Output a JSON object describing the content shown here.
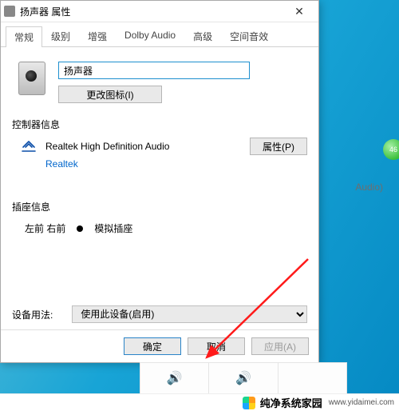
{
  "background": {
    "audio_label": "Audio)"
  },
  "dialog": {
    "title": "扬声器 属性",
    "tabs": [
      "常规",
      "级别",
      "增强",
      "Dolby Audio",
      "高级",
      "空间音效"
    ],
    "ok": "确定",
    "cancel": "取消",
    "apply": "应用(A)"
  },
  "general": {
    "device_name": "扬声器",
    "change_icon_label": "更改图标(I)",
    "controller_section": "控制器信息",
    "controller_name": "Realtek High Definition Audio",
    "provider": "Realtek",
    "properties_label": "属性(P)",
    "jack_section": "插座信息",
    "jack_channels": "左前 右前",
    "jack_type": "模拟插座",
    "usage_label": "设备用法:",
    "usage_value": "使用此设备(启用)"
  },
  "watermark": {
    "name": "纯净系统家园",
    "url": "www.yidaimei.com"
  }
}
